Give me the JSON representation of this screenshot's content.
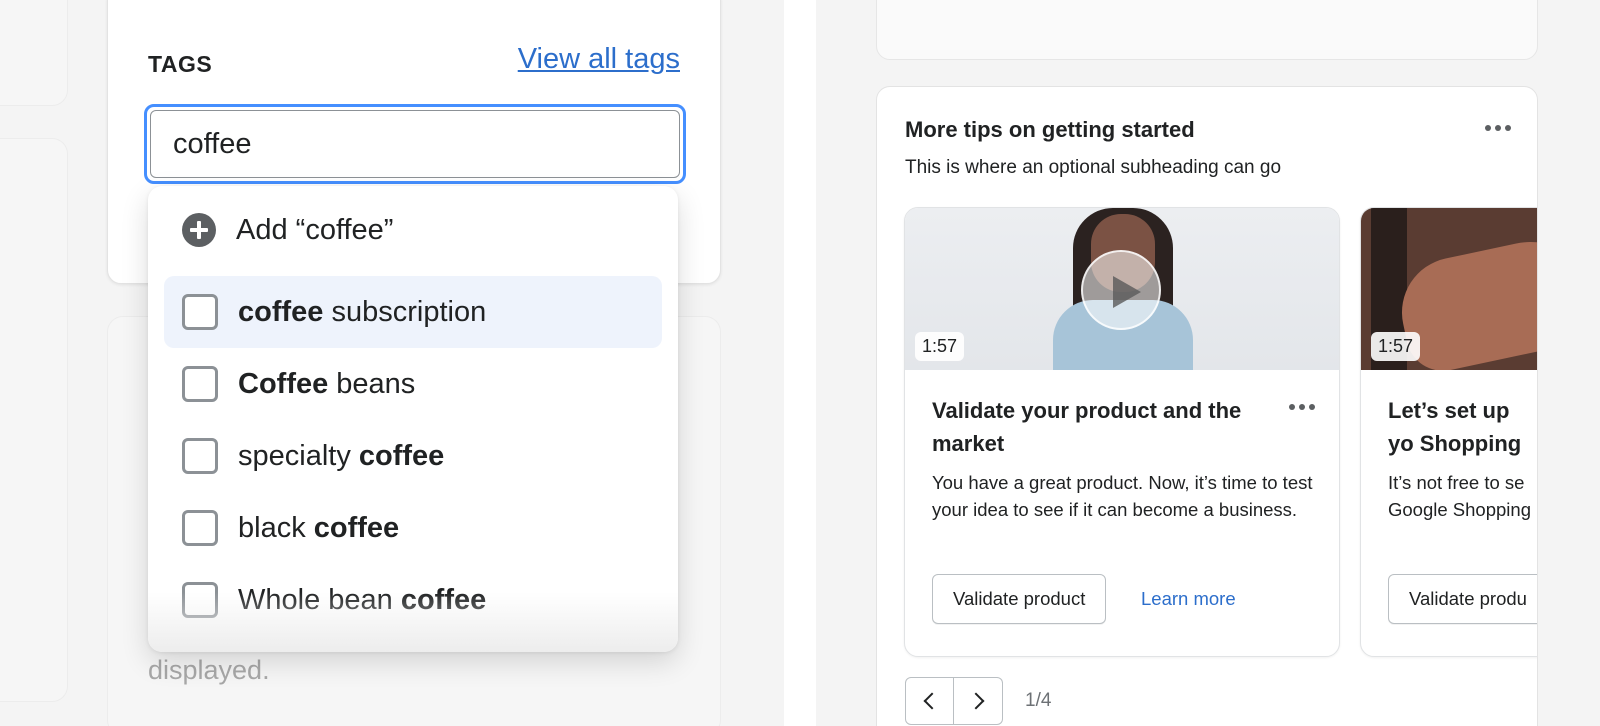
{
  "tags": {
    "title": "TAGS",
    "view_all": "View all tags",
    "input_value": "coffee",
    "add_option": "Add “coffee”",
    "options": [
      {
        "before": "",
        "bold": "coffee",
        "after": " subscription",
        "active": true
      },
      {
        "before": "",
        "bold": "Coffee",
        "after": " beans",
        "active": false
      },
      {
        "before": "specialty ",
        "bold": "coffee",
        "after": "",
        "active": false
      },
      {
        "before": "black ",
        "bold": "coffee",
        "after": "",
        "active": false
      },
      {
        "before": "Whole bean ",
        "bold": "coffee",
        "after": "",
        "active": false
      }
    ]
  },
  "background_card": {
    "text": "displayed."
  },
  "tips": {
    "title": "More tips on getting started",
    "subtitle": "This is where an optional subheading can go",
    "lessons": [
      {
        "duration": "1:57",
        "title": "Validate your product and the market",
        "description": "You have a great product. Now, it’s time to test your idea to see if it can become a business.",
        "primary_button": "Validate product",
        "link": "Learn more"
      },
      {
        "duration": "1:57",
        "title": "Let’s set up yo Shopping",
        "description": "It’s not free to se Google Shopping",
        "primary_button": "Validate produ"
      }
    ],
    "pager": "1/4"
  },
  "colors": {
    "link": "#2c6ecb",
    "focus_ring": "#458fff",
    "active_row": "#eef3fc"
  }
}
